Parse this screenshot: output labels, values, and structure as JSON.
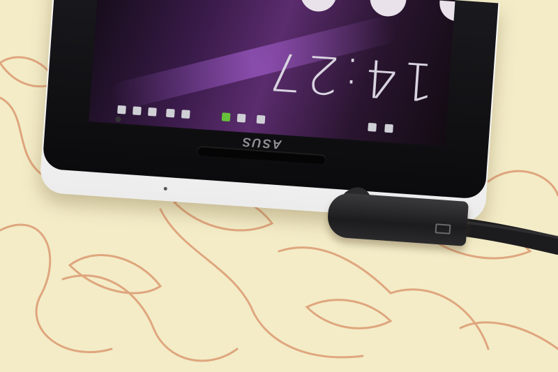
{
  "scene": {
    "description_colors": {
      "tablecloth": "#f3ecc7",
      "floral_line": "#e0a07a",
      "phone_body": "#f2f2f2",
      "phone_front": "#111114",
      "cable": "#1f1f21"
    }
  },
  "phone": {
    "brand": "ASUS",
    "screen": {
      "clock": "14:27",
      "statusbar_icons": [
        "notification-icon",
        "notification-icon",
        "notification-icon",
        "app-icon",
        "app-icon",
        "app-icon",
        "app-icon",
        "wifi-icon",
        "signal-icon",
        "battery-icon"
      ]
    }
  }
}
